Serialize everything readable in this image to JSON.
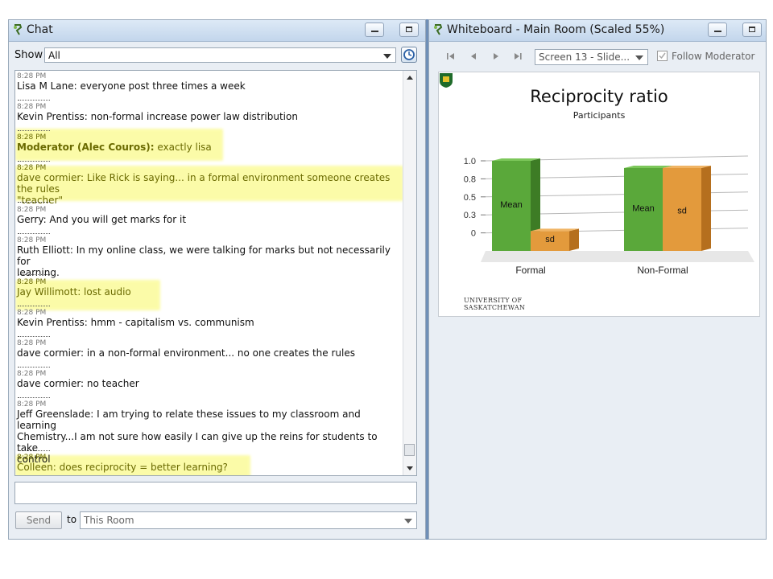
{
  "chat": {
    "title": "Chat",
    "show_label": "Show",
    "filter_value": "All",
    "messages": [
      {
        "time": "8:28 PM",
        "text": "Lisa M Lane: everyone post three times a week"
      },
      {
        "time": "8:28 PM",
        "text": "Kevin Prentiss: non-formal increase power law distribution"
      },
      {
        "time": "8:28 PM",
        "name": "Moderator (Alec Couros):",
        "text": " exactly lisa"
      },
      {
        "time": "8:28 PM",
        "text": "dave cormier: Like Rick is saying... in a formal environment someone creates the rules",
        "text2": "\"teacher\""
      },
      {
        "time": "8:28 PM",
        "text": "Gerry: And you will get marks for it"
      },
      {
        "time": "8:28 PM",
        "text": "Ruth Elliott: In my online class, we were talking for marks but not necessarily for",
        "text2": "learning."
      },
      {
        "time": "8:28 PM",
        "text": "Jay Willimott: lost audio"
      },
      {
        "time": "8:28 PM",
        "text": "Kevin Prentiss: hmm - capitalism vs. communism"
      },
      {
        "time": "8:28 PM",
        "text": "dave cormier: in a non-formal environment... no one creates the rules"
      },
      {
        "time": "8:28 PM",
        "text": "dave cormier: no teacher"
      },
      {
        "time": "8:28 PM",
        "text": "Jeff Greenslade: I am trying to relate these issues to my classroom and learning",
        "text2": "Chemistry...I am not sure how easily I can give up the reins for students to take",
        "text3": "control"
      },
      {
        "time": "8:28 PM",
        "text": "Colleen: does reciprocity = better learning?"
      }
    ],
    "send_label": "Send",
    "to_label": "to",
    "recipient_value": "This Room"
  },
  "whiteboard": {
    "title": "Whiteboard - Main Room (Scaled 55%)",
    "screen_value": "Screen 13 - Slide...",
    "follow_label": "Follow Moderator",
    "follow_checked": true,
    "slide": {
      "university_line1": "UNIVERSITY OF",
      "university_line2": "SASKATCHEWAN"
    }
  },
  "chart_data": {
    "type": "bar",
    "title": "Reciprocity ratio",
    "subtitle": "Participants",
    "categories": [
      "Formal",
      "Non-Formal"
    ],
    "series": [
      {
        "name": "Mean",
        "values": [
          1.0,
          0.92
        ]
      },
      {
        "name": "sd",
        "values": [
          0.22,
          0.92
        ]
      }
    ],
    "yticks": [
      "1.0",
      "0.8",
      "0.5",
      "0.3",
      "0"
    ],
    "ylim": [
      0,
      1.0
    ],
    "colors": {
      "Mean": "#5aa83a",
      "sd": "#e39a3c"
    }
  }
}
